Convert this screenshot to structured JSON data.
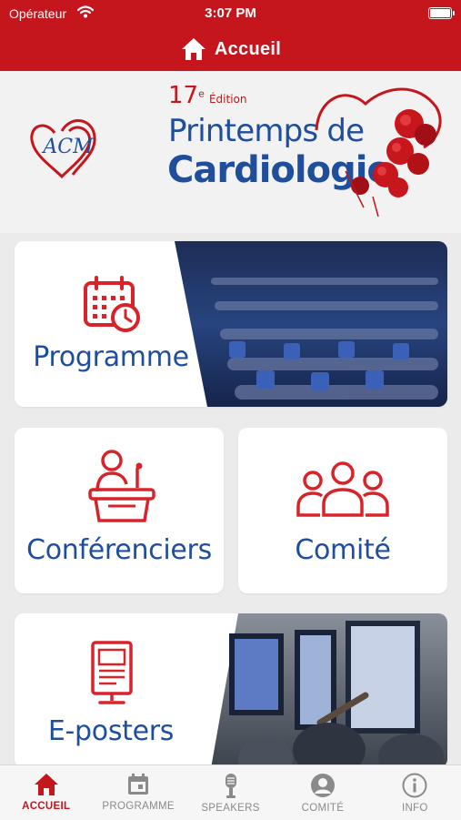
{
  "status_bar": {
    "carrier": "Opérateur",
    "time": "3:07 PM"
  },
  "header": {
    "title": "Accueil"
  },
  "banner": {
    "edition_number": "17",
    "edition_sup": "e",
    "edition_word": "Édition",
    "line1": "Printemps de",
    "line2": "Cardiologie",
    "logo_text": "ACM"
  },
  "tiles": {
    "programme": "Programme",
    "conferenciers": "Conférenciers",
    "comite": "Comité",
    "eposters": "E-posters"
  },
  "tabbar": {
    "items": [
      {
        "label": "ACCUEIL",
        "icon": "home-icon",
        "active": true
      },
      {
        "label": "PROGRAMME",
        "icon": "calendar-icon",
        "active": false
      },
      {
        "label": "SPEAKERS",
        "icon": "microphone-icon",
        "active": false
      },
      {
        "label": "COMITÉ",
        "icon": "user-icon",
        "active": false
      },
      {
        "label": "INFO",
        "icon": "info-icon",
        "active": false
      }
    ]
  },
  "colors": {
    "brand_red": "#c4161c",
    "brand_blue": "#1f4e9c",
    "background": "#ebebeb",
    "tab_inactive": "#8a8a8a"
  }
}
